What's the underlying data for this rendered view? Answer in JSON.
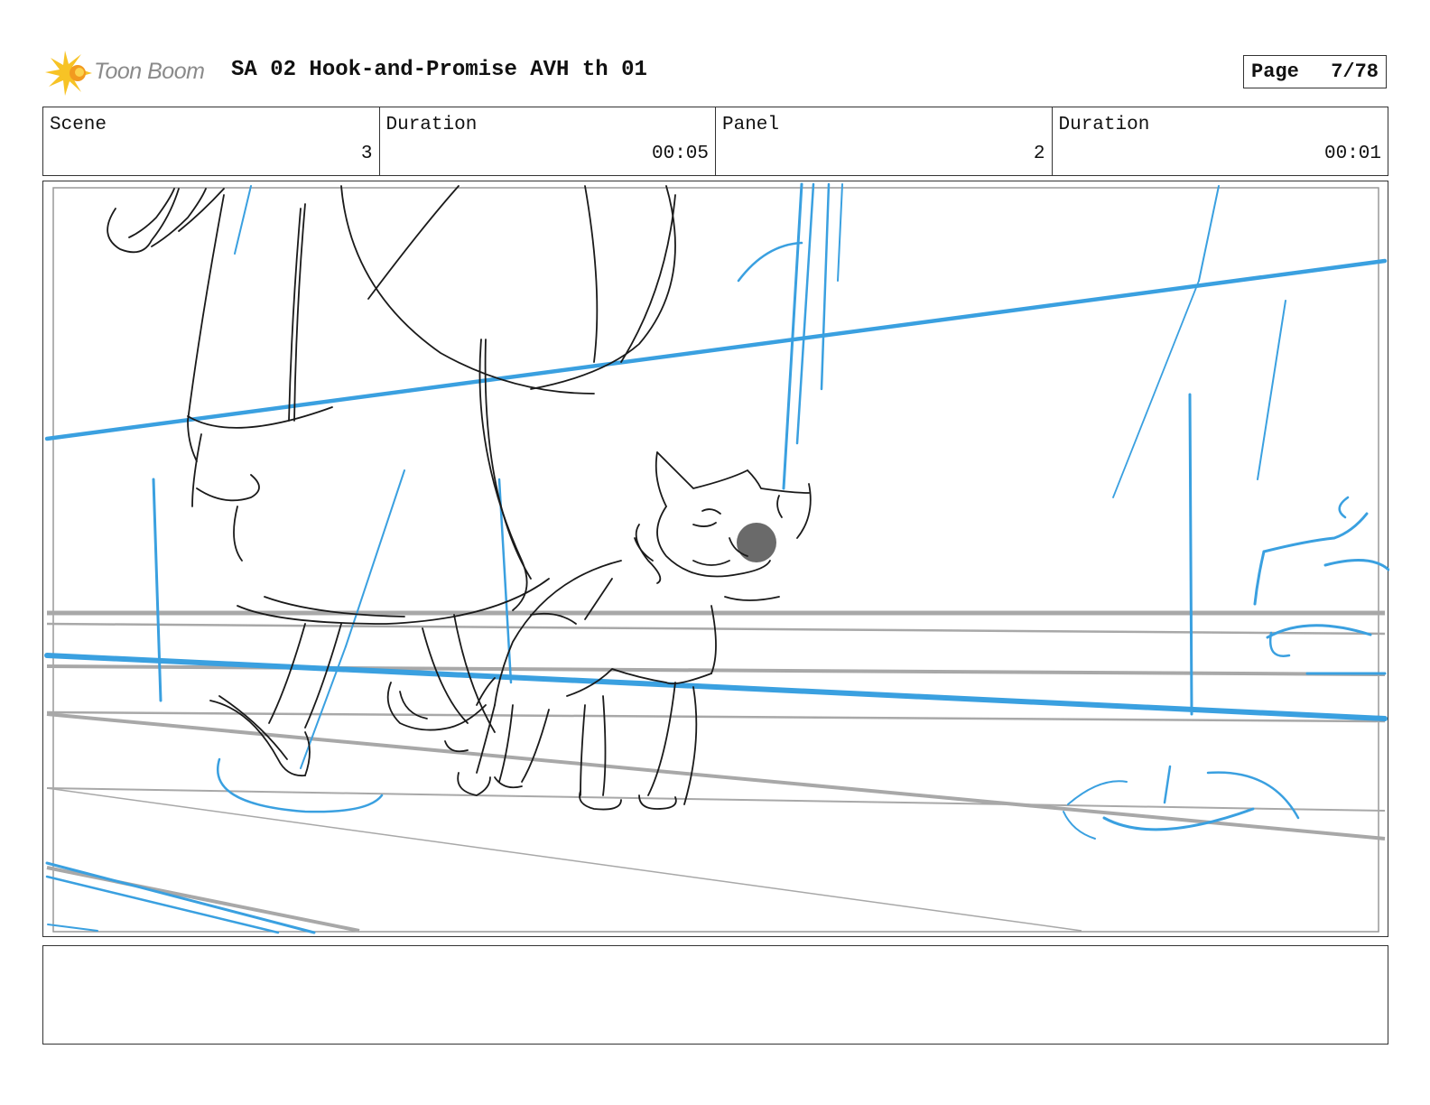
{
  "header": {
    "logo_text": "Toon Boom",
    "title": "SA 02 Hook-and-Promise AVH th 01",
    "page_label": "Page",
    "page_value": "7/78"
  },
  "info": {
    "scene_label": "Scene",
    "scene_value": "3",
    "scene_duration_label": "Duration",
    "scene_duration_value": "00:05",
    "panel_label": "Panel",
    "panel_value": "2",
    "panel_duration_label": "Duration",
    "panel_duration_value": "00:01"
  },
  "colors": {
    "sketch_blue": "#3aa0e0",
    "sketch_black": "#1a1a1a",
    "sketch_gray": "#a8a8a8",
    "logo_yellow": "#f7c325",
    "logo_orange": "#f29a1f"
  },
  "icons": {
    "logo": "toon-boom-starburst-icon"
  }
}
